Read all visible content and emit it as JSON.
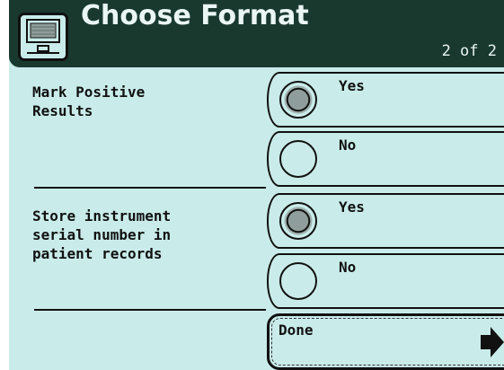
{
  "header": {
    "title": "Choose Format",
    "page_indicator": "2 of 2",
    "icon": "monitor-icon"
  },
  "sections": [
    {
      "label": "Mark Positive\nResults",
      "options": [
        {
          "label": "Yes",
          "selected": true
        },
        {
          "label": "No",
          "selected": false
        }
      ]
    },
    {
      "label": "Store instrument\nserial number in\npatient records",
      "options": [
        {
          "label": "Yes",
          "selected": true
        },
        {
          "label": "No",
          "selected": false
        }
      ]
    }
  ],
  "footer": {
    "done_label": "Done",
    "done_icon": "arrow-right-icon"
  },
  "colors": {
    "background": "#c9ecea",
    "header": "#19392f",
    "header_text": "#eaf6f4",
    "ink": "#111111"
  }
}
